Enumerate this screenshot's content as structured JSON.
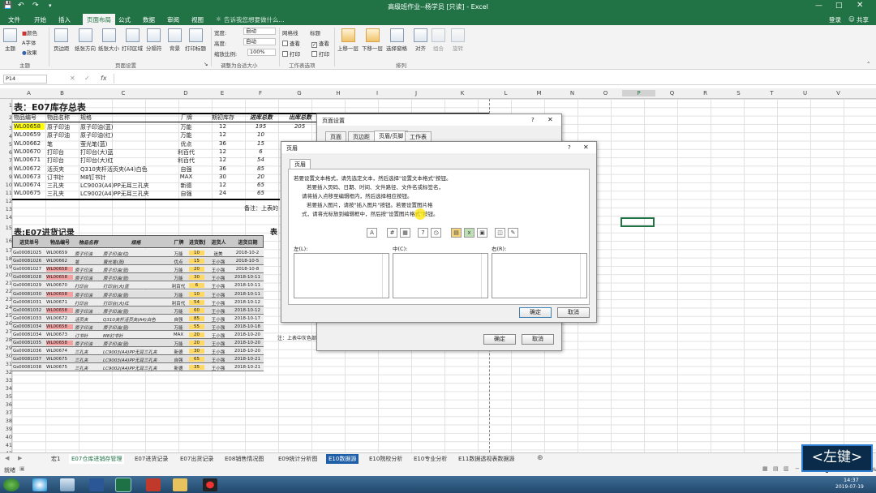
{
  "window": {
    "title": "高级班作业--杨学员 [只读] - Excel",
    "brand_color": "#217346"
  },
  "menu": {
    "tabs": [
      "文件",
      "开始",
      "插入",
      "页面布局",
      "公式",
      "数据",
      "审阅",
      "视图"
    ],
    "tell_me": "告诉我您想要做什么...",
    "login": "登录",
    "share": "共享"
  },
  "ribbon": {
    "theme": {
      "main": "主题",
      "colors": "颜色",
      "fonts": "字体",
      "effects": "效果",
      "group": "主题"
    },
    "page_setup": {
      "margins": "页边距",
      "orientation": "纸张方向",
      "size": "纸张大小",
      "print_area": "打印区域",
      "breaks": "分隔符",
      "background": "背景",
      "print_titles": "打印标题",
      "group": "页面设置"
    },
    "scale": {
      "width_label": "宽度:",
      "width_value": "自动",
      "height_label": "高度:",
      "height_value": "自动",
      "scale_label": "缩放比例:",
      "scale_value": "100%",
      "group": "调整为合适大小"
    },
    "sheet_options": {
      "gridlines": "网格线",
      "headings": "标题",
      "view1": "查看",
      "view2": "查看",
      "print1": "打印",
      "print2": "打印",
      "group": "工作表选项"
    },
    "arrange": {
      "bring_forward": "上移一层",
      "send_backward": "下移一层",
      "selection_pane": "选择窗格",
      "align": "对齐",
      "group_btn": "组合",
      "rotate": "旋转",
      "group": "排列"
    }
  },
  "formula_bar": {
    "name_box": "P14",
    "fx": "fx",
    "formula": ""
  },
  "columns": [
    "A",
    "B",
    "C",
    "D",
    "E",
    "F",
    "G",
    "H",
    "I",
    "J",
    "K",
    "L",
    "M",
    "N",
    "O",
    "P",
    "Q",
    "R",
    "S",
    "T",
    "U",
    "V"
  ],
  "rows": [
    "1",
    "2",
    "3",
    "4",
    "5",
    "6",
    "7",
    "8",
    "9",
    "10",
    "11",
    "12",
    "13",
    "14",
    "15",
    "16",
    "17",
    "18",
    "19",
    "20",
    "21",
    "22",
    "23",
    "24",
    "25",
    "26",
    "27",
    "28",
    "29",
    "30",
    "31",
    "32",
    "33",
    "34",
    "35",
    "36",
    "37",
    "38",
    "39",
    "40",
    "41",
    "42"
  ],
  "table1": {
    "title": "表：E07库存总表",
    "headers": [
      "物品编号",
      "物品名称",
      "规格",
      "厂牌",
      "期初库存",
      "进库总数",
      "出库总数"
    ],
    "rows": [
      [
        "WL00658",
        "原子印油",
        "原子印油(蓝)",
        "万能",
        "12",
        "195",
        "205"
      ],
      [
        "WL00659",
        "原子印油",
        "原子印油(红)",
        "万能",
        "12",
        "10",
        ""
      ],
      [
        "WL00662",
        "笔",
        "萤光笔(蓝)",
        "优点",
        "36",
        "15",
        ""
      ],
      [
        "WL00670",
        "打印台",
        "打印台(大)蓝",
        "利百代",
        "12",
        "6",
        ""
      ],
      [
        "WL00671",
        "打印台",
        "打印台(大)红",
        "利百代",
        "12",
        "54",
        ""
      ],
      [
        "WL00672",
        "活页夹",
        "Q310夹杆活页夹(A4)白色",
        "自强",
        "36",
        "85",
        ""
      ],
      [
        "WL00673",
        "订书针",
        "M8钉书针",
        "MAX",
        "30",
        "20",
        ""
      ],
      [
        "WL00674",
        "三孔夹",
        "LC9003(A4)PP无耳三孔夹",
        "新德",
        "12",
        "65",
        ""
      ],
      [
        "WL00675",
        "三孔夹",
        "LC9002(A4)PP无耳三孔夹",
        "自强",
        "24",
        "65",
        ""
      ]
    ],
    "note": "备注：上表的"
  },
  "table2": {
    "title": "表:E07进货记录",
    "headers": [
      "进货单号",
      "物品编号",
      "物品名称",
      "规格",
      "厂牌",
      "进货数量",
      "进货人",
      "进货日期"
    ],
    "rows": [
      [
        "Gs00081025",
        "WL00659",
        "原子印油",
        "原子印油(红)",
        "万能",
        "10",
        "迷美",
        "2018-10-2"
      ],
      [
        "Gs00081026",
        "WL00662",
        "笔",
        "萤光笔(蓝)",
        "优点",
        "15",
        "王小强",
        "2018-10-5"
      ],
      [
        "Gs00081027",
        "WL00658",
        "原子印油",
        "原子印油(蓝)",
        "万能",
        "20",
        "王小强",
        "2018-10-8"
      ],
      [
        "Gs00081028",
        "WL00658",
        "原子印油",
        "原子印油(蓝)",
        "万能",
        "30",
        "王小强",
        "2018-10-11"
      ],
      [
        "Gs00081029",
        "WL00670",
        "打印台",
        "打印台(大)蓝",
        "利百代",
        "6",
        "王小强",
        "2018-10-11"
      ],
      [
        "Gs00081030",
        "WL00658",
        "原子印油",
        "原子印油(蓝)",
        "万能",
        "10",
        "王小强",
        "2018-10-11"
      ],
      [
        "Gs00081031",
        "WL00671",
        "打印台",
        "打印台(大)红",
        "利百代",
        "54",
        "王小强",
        "2018-10-12"
      ],
      [
        "Gs00081032",
        "WL00658",
        "原子印油",
        "原子印油(蓝)",
        "万能",
        "60",
        "王小强",
        "2018-10-12"
      ],
      [
        "Gs00081033",
        "WL00672",
        "活页夹",
        "Q310夹杆活页夹(A4)白色",
        "自强",
        "85",
        "王小强",
        "2018-10-17"
      ],
      [
        "Gs00081034",
        "WL00658",
        "原子印油",
        "原子印油(蓝)",
        "万能",
        "55",
        "王小强",
        "2018-10-18"
      ],
      [
        "Gs00081034",
        "WL00673",
        "订书针",
        "M8钉书针",
        "MAX",
        "20",
        "王小强",
        "2018-10-20"
      ],
      [
        "Gs00081035",
        "WL00658",
        "原子印油",
        "原子印油(蓝)",
        "万能",
        "20",
        "王小强",
        "2018-10-20"
      ],
      [
        "Gs00081036",
        "WL00674",
        "三孔夹",
        "LC9003(A4)PP无耳三孔夹",
        "新德",
        "30",
        "王小强",
        "2018-10-20"
      ],
      [
        "Gs00081037",
        "WL00675",
        "三孔夹",
        "LC9003(A4)PP无耳三孔夹",
        "自强",
        "65",
        "王小强",
        "2018-10-21"
      ],
      [
        "Gs00081038",
        "WL00675",
        "三孔夹",
        "LC9002(A4)PP无耳三孔夹",
        "新德",
        "35",
        "王小强",
        "2018-10-21"
      ]
    ],
    "right_header": "表",
    "right_note": "注：上表中灰色部分。"
  },
  "dialog_back": {
    "title": "页面设置",
    "tabs": [
      "页面",
      "页边距",
      "页眉/页脚",
      "工作表"
    ],
    "ok": "确定",
    "cancel": "取消"
  },
  "dialog_front": {
    "title": "页眉",
    "tab": "页眉",
    "instructions": [
      "若要设置文本格式，请先选定文本，然后选择\"设置文本格式\"按钮。",
      "若要插入页码、日期、时间、文件路径、文件名或标签名，",
      "请将插入点移至编辑框内，然后选择相应按钮。",
      "若要插入图片，请按\"插入图片\"按钮。若要设置图片格",
      "式，请将光标放到编辑框中，然后按\"设置图片格式\"按钮。"
    ],
    "toolbar_icons": [
      "format-text-icon",
      "page-number-icon",
      "page-count-icon",
      "date-icon",
      "time-icon",
      "file-path-icon",
      "file-name-icon",
      "sheet-name-icon",
      "insert-picture-icon",
      "format-picture-icon"
    ],
    "left_label": "左(L):",
    "center_label": "中(C):",
    "right_label": "右(R):",
    "left_value": "",
    "center_value": "",
    "right_value": "",
    "ok": "确定",
    "cancel": "取消"
  },
  "sheets": [
    "宏1",
    "E07仓库进销存管理",
    "E07进货记录",
    "E07出货记录",
    "E08销售情况图",
    "E09统计分析图",
    "E10数据源",
    "E10院校分析",
    "E10专业分析",
    "E11数据透视表数据源"
  ],
  "active_sheet": "E07仓库进销存管理",
  "status": {
    "ready": "就绪",
    "zoom": "100%"
  },
  "clock": {
    "time": "14:37",
    "date": "2019-07-19"
  },
  "overlay_key": "<左键>"
}
